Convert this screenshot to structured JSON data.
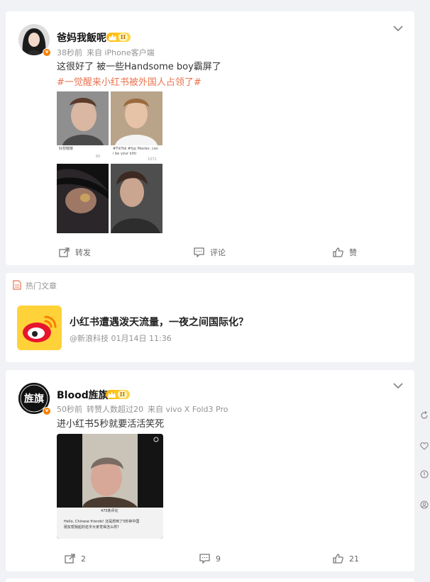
{
  "post1": {
    "username": "爸妈我飯呢",
    "level": "II",
    "time": "38秒前",
    "source": "来自 iPhone客户端",
    "text": "这很好了 被一些Handsome boy霸屏了",
    "hashtag": "#一觉醒来小红书被外国人占领了#",
    "grid": {
      "caption_top_left": "好想散散",
      "likes_top_left": "60",
      "caption_top_right_1": "#TikTok #fyp Master, can",
      "caption_top_right_2": "i be your kitti",
      "likes_top_right": "1071"
    },
    "actions": {
      "repost": "转发",
      "comment": "评论",
      "like": "赞"
    }
  },
  "hot": {
    "label": "热门文章",
    "title": "小红书遭遇泼天流量，一夜之间国际化？",
    "source": "@新浪科技 01月14日 11:36"
  },
  "post2": {
    "username": "Blood旌旗",
    "level": "II",
    "avatar_text": "旌旗",
    "time": "50秒前",
    "reposts_note": "转赞人数超过20",
    "source": "来自 vivo X Fold3 Pro",
    "text": "进小红书5秒就要活活笑死",
    "video": {
      "comment_header": "475条评论",
      "comment_text_1": "Hello, Chinese friends! 还是想到了5秒钟中国",
      "comment_text_2": "朋友帮我起的名字大家觉得怎么样?"
    },
    "actions": {
      "repost": "2",
      "comment": "9",
      "like": "21"
    }
  },
  "colors": {
    "hashtag": "#eb7350",
    "badge_orange": "#f78000",
    "weibo_yellow": "#ffd23a",
    "weibo_red": "#e6162d"
  }
}
